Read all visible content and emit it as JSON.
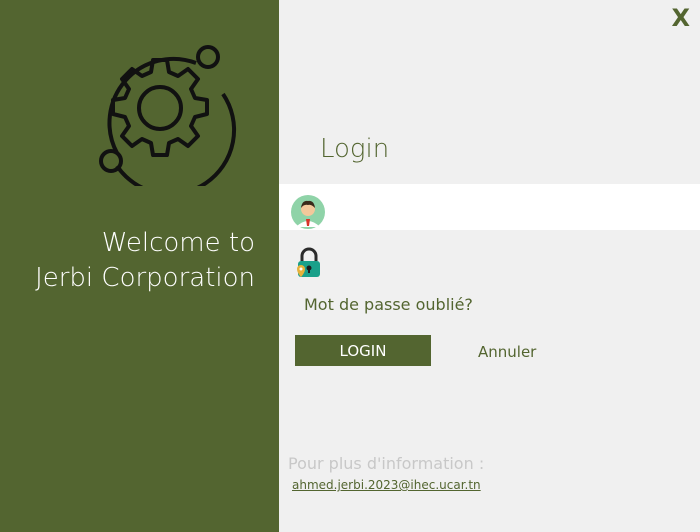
{
  "left": {
    "welcome_line1": "Welcome to",
    "welcome_line2": "Jerbi Corporation",
    "logo_icon": "gear-orbit-icon"
  },
  "header": {
    "close_label": "X"
  },
  "form": {
    "title": "Login",
    "user_icon": "user-avatar-icon",
    "lock_icon": "lock-icon",
    "forgot_label": "Mot de passe oublié?",
    "login_label": "LOGIN",
    "cancel_label": "Annuler"
  },
  "footer": {
    "info_label": "Pour plus d'information :",
    "email": "ahmed.jerbi.2023@ihec.ucar.tn"
  },
  "colors": {
    "brand": "#536530",
    "panel_bg": "#f0f0f0",
    "muted": "#c8c8c8"
  }
}
